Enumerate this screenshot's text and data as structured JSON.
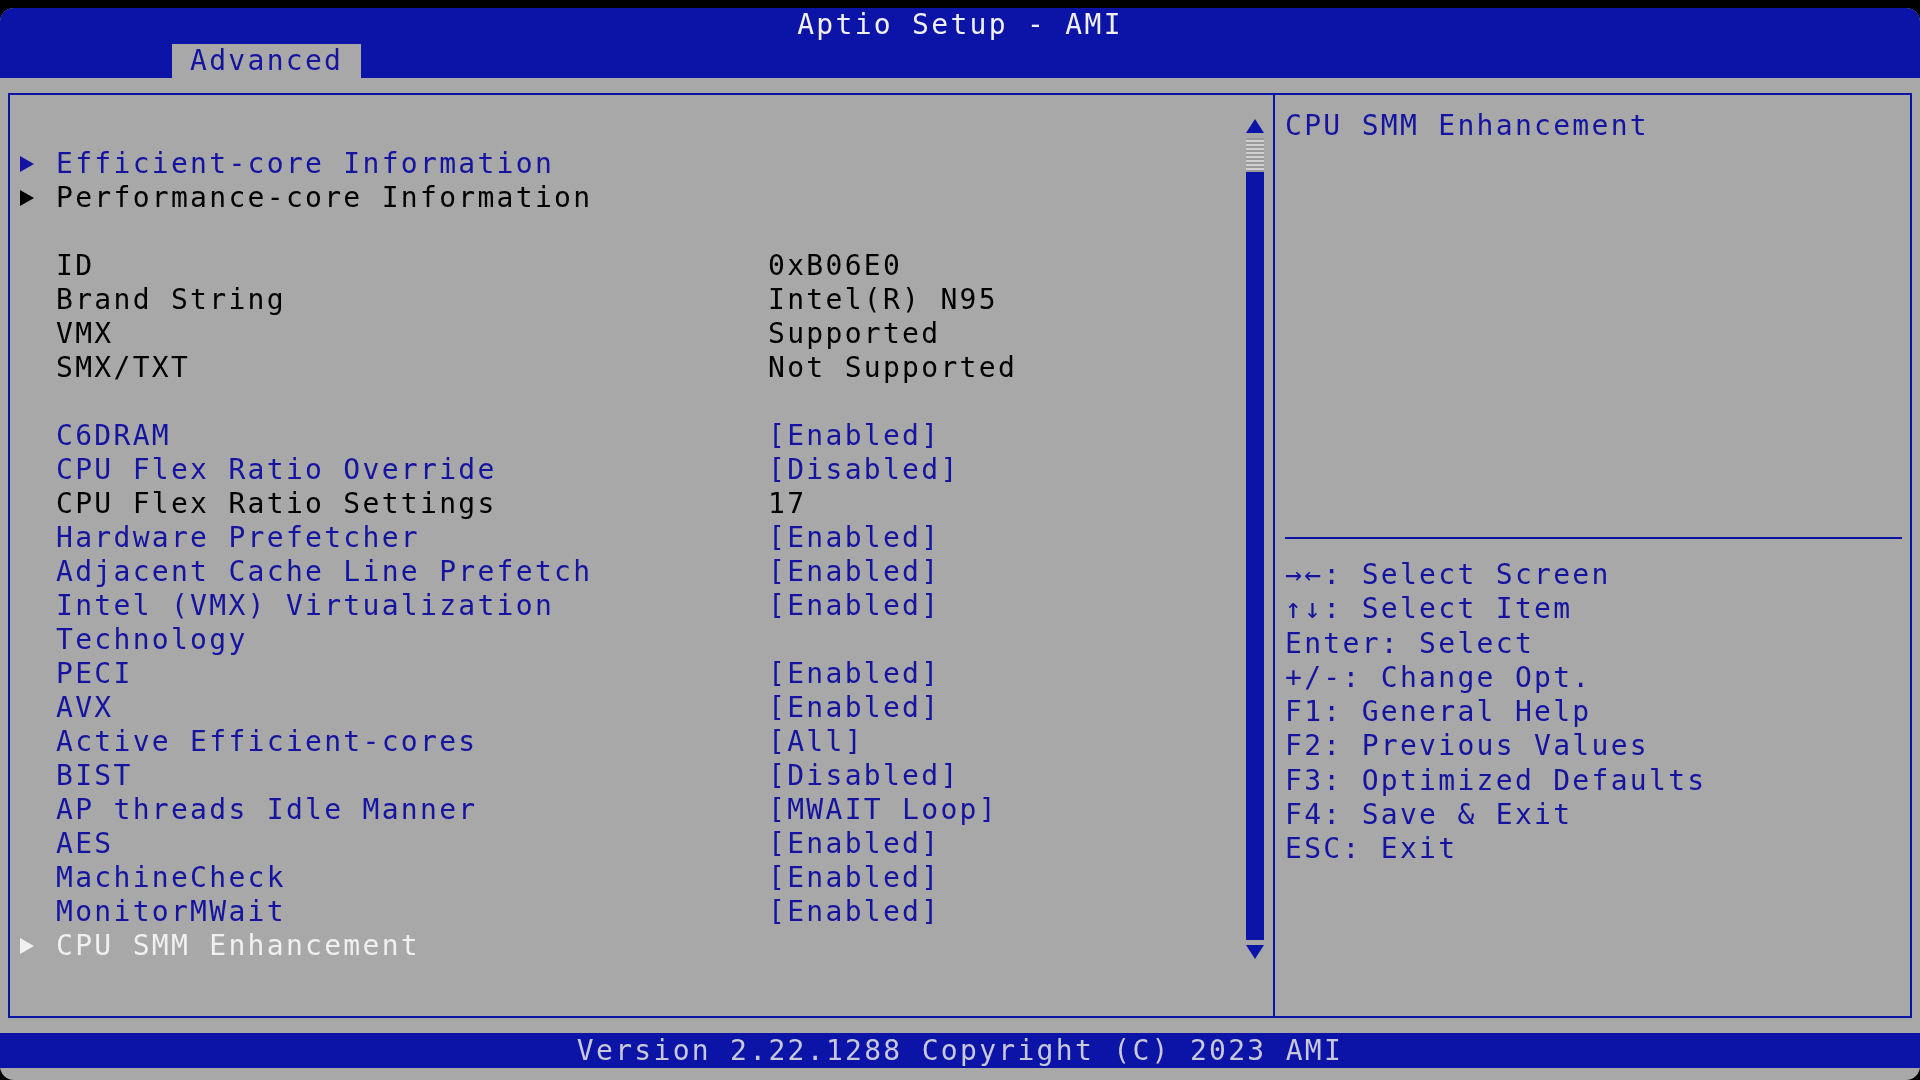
{
  "window": {
    "title": "Aptio Setup - AMI"
  },
  "tabs": [
    {
      "label": "Advanced",
      "selected": true
    }
  ],
  "sections": [
    [
      {
        "kind": "submenu",
        "label": "Efficient-core Information",
        "disabled": false,
        "selected": false
      },
      {
        "kind": "submenu",
        "label": "Performance-core Information",
        "disabled": true,
        "selected": false
      }
    ],
    [
      {
        "kind": "info",
        "label": "ID",
        "value": "0xB06E0"
      },
      {
        "kind": "info",
        "label": "Brand String",
        "value": "Intel(R) N95"
      },
      {
        "kind": "info",
        "label": "VMX",
        "value": "Supported"
      },
      {
        "kind": "info",
        "label": "SMX/TXT",
        "value": "Not Supported"
      }
    ],
    [
      {
        "kind": "setting",
        "label": "C6DRAM",
        "value": "[Enabled]",
        "selected": false
      },
      {
        "kind": "setting",
        "label": "CPU Flex Ratio Override",
        "value": "[Disabled]",
        "selected": false
      },
      {
        "kind": "info",
        "label": "CPU Flex Ratio Settings",
        "value": "17"
      },
      {
        "kind": "setting",
        "label": "Hardware Prefetcher",
        "value": "[Enabled]",
        "selected": false
      },
      {
        "kind": "setting",
        "label": "Adjacent Cache Line Prefetch",
        "value": "[Enabled]",
        "selected": false
      },
      {
        "kind": "setting",
        "label": "Intel (VMX) Virtualization Technology",
        "value": "[Enabled]",
        "selected": false
      },
      {
        "kind": "setting",
        "label": "PECI",
        "value": "[Enabled]",
        "selected": false
      },
      {
        "kind": "setting",
        "label": "AVX",
        "value": "[Enabled]",
        "selected": false
      },
      {
        "kind": "setting",
        "label": "Active Efficient-cores",
        "value": "[All]",
        "selected": false
      },
      {
        "kind": "setting",
        "label": "BIST",
        "value": "[Disabled]",
        "selected": false
      },
      {
        "kind": "setting",
        "label": "AP threads Idle Manner",
        "value": "[MWAIT Loop]",
        "selected": false
      },
      {
        "kind": "setting",
        "label": "AES",
        "value": "[Enabled]",
        "selected": false
      },
      {
        "kind": "setting",
        "label": "MachineCheck",
        "value": "[Enabled]",
        "selected": false
      },
      {
        "kind": "setting",
        "label": "MonitorMWait",
        "value": "[Enabled]",
        "selected": false
      },
      {
        "kind": "submenu",
        "label": "CPU SMM Enhancement",
        "disabled": false,
        "selected": true
      }
    ]
  ],
  "help": {
    "text": "CPU SMM Enhancement"
  },
  "legend": [
    "→←: Select Screen",
    "↑↓: Select Item",
    "Enter: Select",
    "+/-: Change Opt.",
    "F1: General Help",
    "F2: Previous Values",
    "F3: Optimized Defaults",
    "F4: Save & Exit",
    "ESC: Exit"
  ],
  "status_bar": {
    "text": "Version 2.22.1288 Copyright (C) 2023 AMI"
  }
}
